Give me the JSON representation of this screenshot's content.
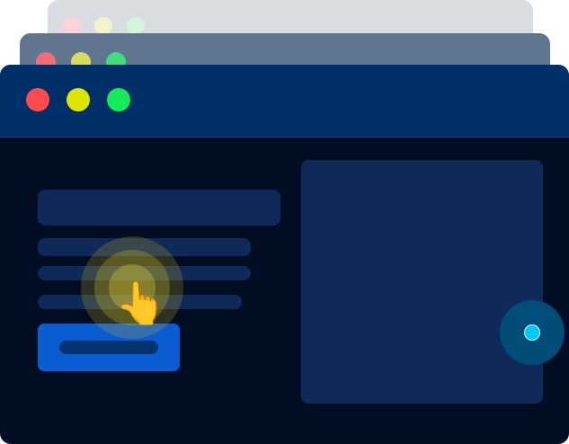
{
  "windows": {
    "back": {
      "traffic_lights": [
        "close",
        "minimize",
        "zoom"
      ]
    },
    "middle": {
      "traffic_lights": [
        "close",
        "minimize",
        "zoom"
      ]
    },
    "front": {
      "traffic_lights": [
        "close",
        "minimize",
        "zoom"
      ],
      "content": {
        "title_placeholder": "",
        "text_line_placeholders": [
          "",
          "",
          ""
        ],
        "button_label": "",
        "image_placeholder": ""
      }
    }
  },
  "icons": {
    "pointer": "tap-hand-icon",
    "cursor": "cursor-dot-icon"
  },
  "colors": {
    "background": "#ffffff",
    "front_window_body": "#000d22",
    "front_window_titlebar": "#002f67",
    "placeholder_block": "#0f2a58",
    "button": "#0b5bd1",
    "traffic_red": "#ff4a4f",
    "traffic_yellow": "#dbe600",
    "traffic_green": "#15eb56",
    "tap_ripple": "#d6c83c",
    "cursor_dot": "#00c7ff"
  }
}
